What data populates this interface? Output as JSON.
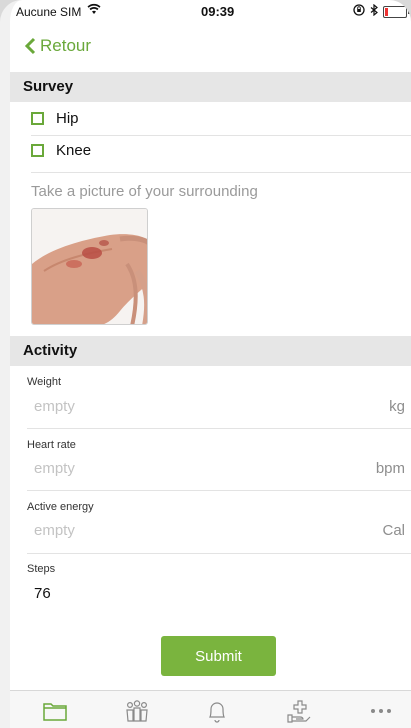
{
  "status_bar": {
    "carrier": "Aucune SIM",
    "wifi_icon": "wifi-icon",
    "time": "09:39",
    "battery_level": 0.15
  },
  "nav": {
    "back_label": "Retour"
  },
  "survey": {
    "title": "Survey",
    "options": [
      {
        "label": "Hip",
        "checked": false
      },
      {
        "label": "Knee",
        "checked": false
      }
    ],
    "photo_prompt": "Take a picture of your surrounding"
  },
  "activity": {
    "title": "Activity",
    "fields": [
      {
        "label": "Weight",
        "value": "empty",
        "unit": "kg"
      },
      {
        "label": "Heart rate",
        "value": "empty",
        "unit": "bpm"
      },
      {
        "label": "Active energy",
        "value": "empty",
        "unit": "Cal"
      },
      {
        "label": "Steps",
        "value": "76",
        "unit": ""
      }
    ]
  },
  "submit_label": "Submit",
  "tab_bar": {
    "tabs": [
      "folder-icon",
      "people-icon",
      "bell-icon",
      "medical-hand-icon",
      "more-icon"
    ],
    "active": "folder-icon"
  },
  "colors": {
    "accent": "#6aa83a",
    "button": "#7ab43e",
    "section_bg": "#e6e6e6"
  }
}
